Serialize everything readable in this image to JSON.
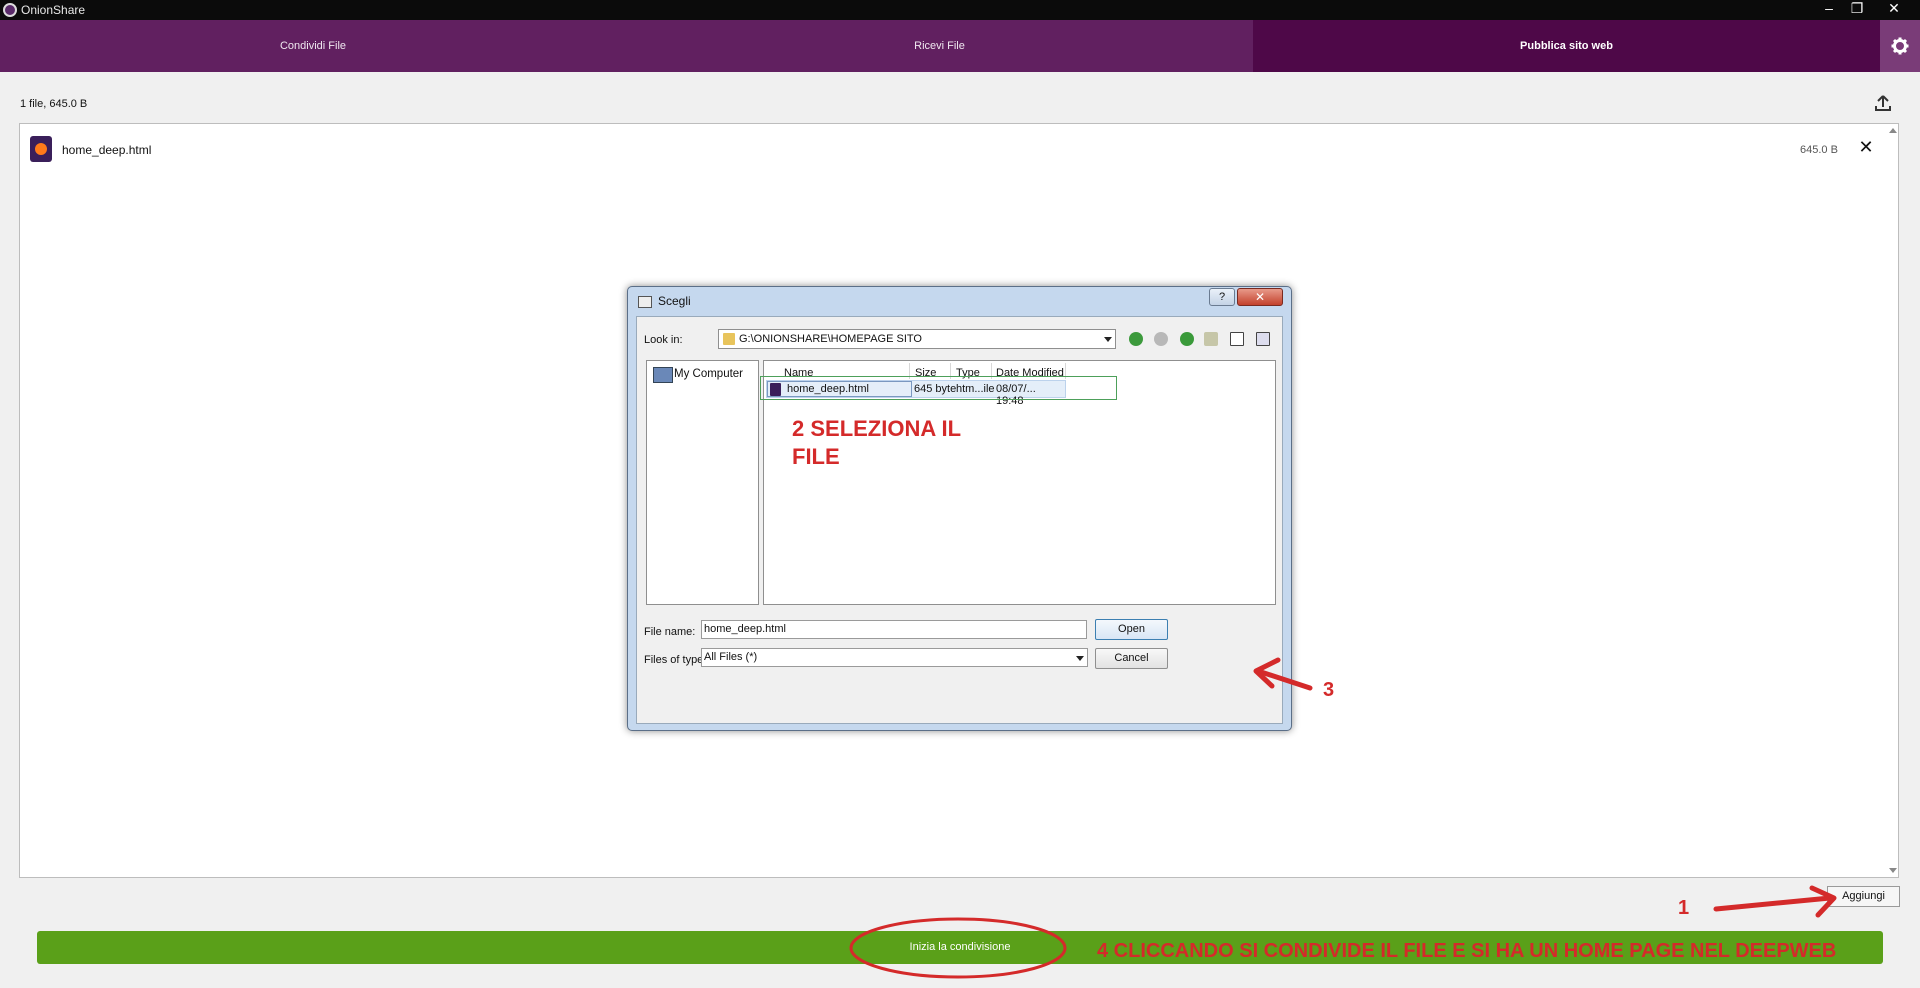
{
  "window": {
    "title": "OnionShare",
    "minimize_glyph": "–",
    "maximize_glyph": "❐",
    "close_glyph": "✕"
  },
  "tabs": [
    {
      "label": "Condividi File"
    },
    {
      "label": "Ricevi File"
    },
    {
      "label": "Pubblica sito web"
    }
  ],
  "summary": "1 file, 645.0 B",
  "files": [
    {
      "name": "home_deep.html",
      "size": "645.0 B",
      "remove_glyph": "✕"
    }
  ],
  "add_button": "Aggiungi",
  "share_button": "Inizia la condivisione",
  "dialog": {
    "title": "Scegli",
    "help_glyph": "?",
    "close_glyph": "✕",
    "look_in_label": "Look in:",
    "look_in_value": "G:\\ONIONSHARE\\HOMEPAGE SITO",
    "sidebar_item": "My Computer",
    "columns": [
      "Name",
      "Size",
      "Type",
      "Date Modified"
    ],
    "rows": [
      {
        "name": "home_deep.html",
        "size": "645 byte",
        "type": "htm...ile",
        "date": "08/07/... 19:48"
      }
    ],
    "file_name_label": "File name:",
    "file_name_value": "home_deep.html",
    "file_type_label": "Files of type:",
    "file_type_value": "All Files (*)",
    "open_button": "Open",
    "cancel_button": "Cancel"
  },
  "annotations": {
    "step1": "1",
    "step2": "2 SELEZIONA IL FILE",
    "step3": "3",
    "step4": "4  CLICCANDO SI CONDIVIDE IL FILE E SI HA UN HOME PAGE NEL DEEPWEB",
    "color": "#d42a2a"
  },
  "colors": {
    "tab_bar": "#612060",
    "tab_active": "#4e0848",
    "share_green": "#5aa019"
  },
  "icons": [
    "onionshare-icon",
    "gear-icon",
    "upload-icon",
    "html-file-icon",
    "close-icon",
    "folder-icon",
    "computer-icon"
  ]
}
